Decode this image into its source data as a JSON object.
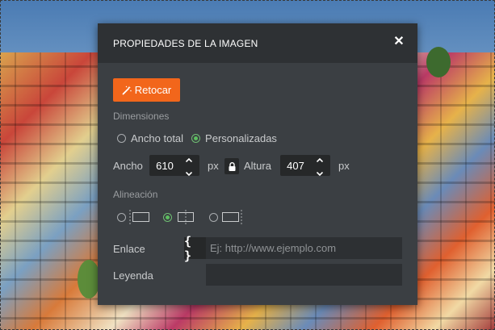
{
  "dialog": {
    "title": "PROPIEDADES DE LA IMAGEN",
    "close_icon": "close-icon",
    "retouch_label": "Retocar",
    "retouch_icon": "magic-wand-icon",
    "accent_color": "#f2661b"
  },
  "dimensions": {
    "section_label": "Dimensiones",
    "options": [
      {
        "label": "Ancho total",
        "selected": false
      },
      {
        "label": "Personalizadas",
        "selected": true
      }
    ],
    "width_label": "Ancho",
    "width_value": "610",
    "width_unit": "px",
    "lock_icon": "lock-icon",
    "height_label": "Altura",
    "height_value": "407",
    "height_unit": "px"
  },
  "alignment": {
    "section_label": "Alineación",
    "options": [
      {
        "icon": "align-left-icon",
        "selected": false
      },
      {
        "icon": "align-center-icon",
        "selected": true
      },
      {
        "icon": "align-right-icon",
        "selected": false
      }
    ]
  },
  "link": {
    "label": "Enlace",
    "icon_text": "{ }",
    "value": "",
    "placeholder": "Ej: http://www.ejemplo.com"
  },
  "caption": {
    "label": "Leyenda",
    "value": ""
  },
  "colors": {
    "selected_radio": "#5cbf5f",
    "dialog_bg": "#3b3f43",
    "header_bg": "#2e3134"
  }
}
